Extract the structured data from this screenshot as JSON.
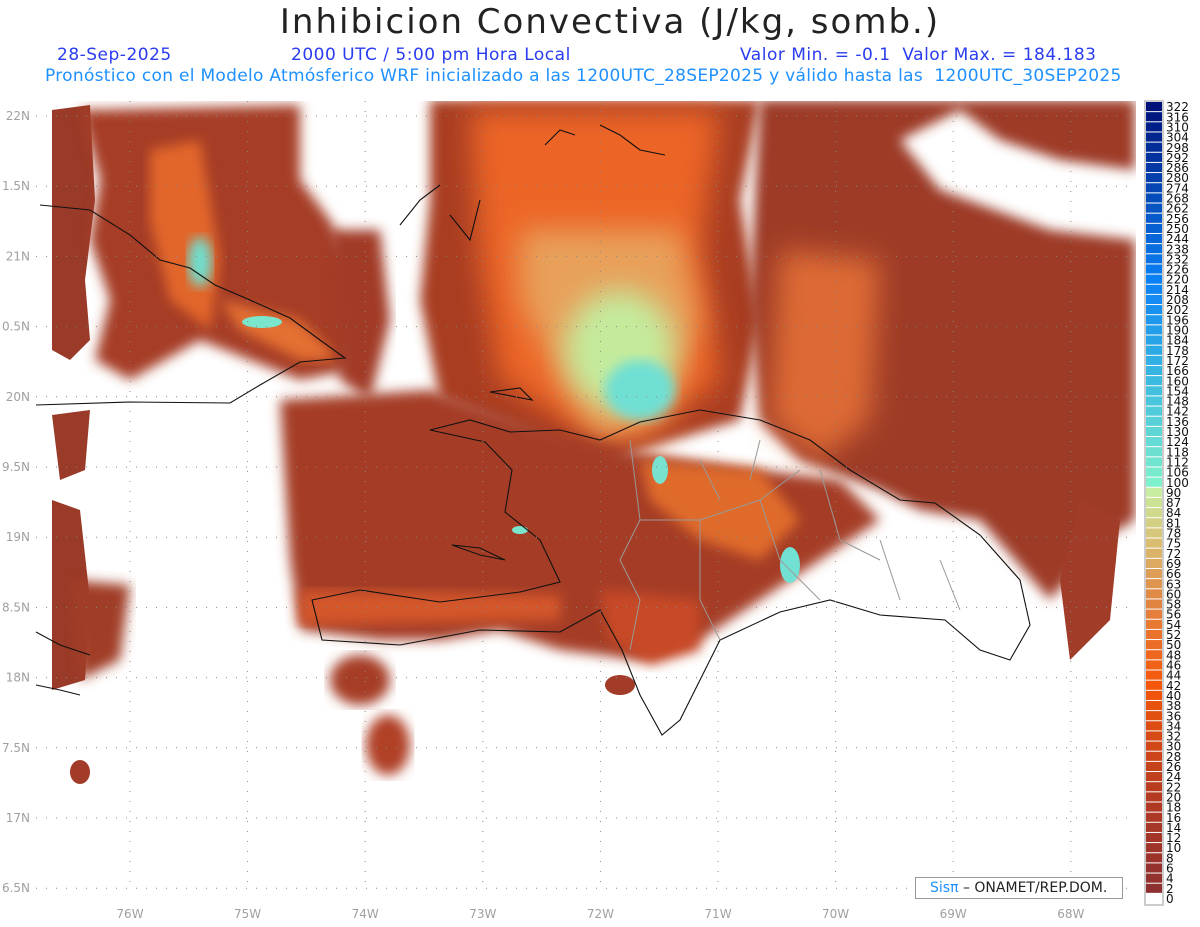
{
  "header": {
    "title": "Inhibicion Convectiva (J/kg, somb.)",
    "date": "28-Sep-2025",
    "time": "2000 UTC / 5:00 pm Hora Local",
    "min_max": "Valor Min. = -0.1  Valor Max. = 184.183",
    "subtitle": "Pronóstico con el Modelo Atmósferico WRF inicializado a las 1200UTC_28SEP2025 y válido hasta las  1200UTC_30SEP2025"
  },
  "axes": {
    "lat_labels": [
      "22N",
      "1.5N",
      "21N",
      "0.5N",
      "20N",
      "9.5N",
      "19N",
      "8.5N",
      "18N",
      "7.5N",
      "17N",
      "6.5N"
    ],
    "lon_labels": [
      "76W",
      "75W",
      "74W",
      "73W",
      "72W",
      "71W",
      "70W",
      "69W",
      "68W"
    ]
  },
  "colorbar": {
    "labels": [
      "322",
      "316",
      "310",
      "304",
      "298",
      "292",
      "286",
      "280",
      "274",
      "268",
      "262",
      "256",
      "250",
      "244",
      "238",
      "232",
      "226",
      "220",
      "214",
      "208",
      "202",
      "196",
      "190",
      "184",
      "178",
      "172",
      "166",
      "160",
      "154",
      "148",
      "142",
      "136",
      "130",
      "124",
      "118",
      "112",
      "106",
      "100",
      "90",
      "87",
      "84",
      "81",
      "78",
      "75",
      "72",
      "69",
      "66",
      "63",
      "60",
      "58",
      "56",
      "54",
      "52",
      "50",
      "48",
      "46",
      "44",
      "42",
      "40",
      "38",
      "36",
      "34",
      "32",
      "30",
      "28",
      "26",
      "24",
      "22",
      "20",
      "18",
      "16",
      "14",
      "12",
      "10",
      "8",
      "6",
      "4",
      "2",
      "0"
    ],
    "color_stops": [
      [
        0,
        "#ffffff"
      ],
      [
        2,
        "#8e3030"
      ],
      [
        20,
        "#b43a22"
      ],
      [
        42,
        "#f5560a"
      ],
      [
        60,
        "#e08a48"
      ],
      [
        75,
        "#d9bd70"
      ],
      [
        90,
        "#c9eda0"
      ],
      [
        100,
        "#7ff0cc"
      ],
      [
        160,
        "#3cbbe0"
      ],
      [
        220,
        "#0a80f5"
      ],
      [
        322,
        "#00127a"
      ]
    ]
  },
  "credit": {
    "brand": "Sis",
    "brand_symbol": "π",
    "org": " – ONAMET/REP.DOM."
  }
}
